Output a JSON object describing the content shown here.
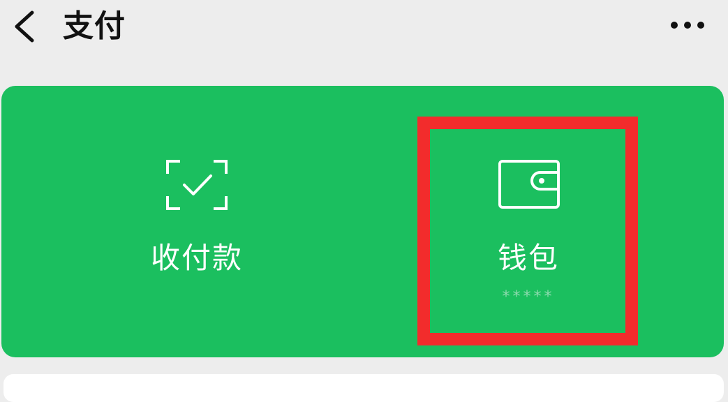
{
  "header": {
    "title": "支付",
    "back_icon": "chevron-left-icon",
    "more_icon": "more-horizontal-icon"
  },
  "pay_card": {
    "background_color": "#1bbf5f",
    "actions": [
      {
        "label": "收付款",
        "icon": "scan-check-icon"
      },
      {
        "label": "钱包",
        "icon": "wallet-icon",
        "balance": "*****"
      }
    ]
  },
  "highlight": {
    "color": "#f22c2c",
    "target": "wallet"
  }
}
